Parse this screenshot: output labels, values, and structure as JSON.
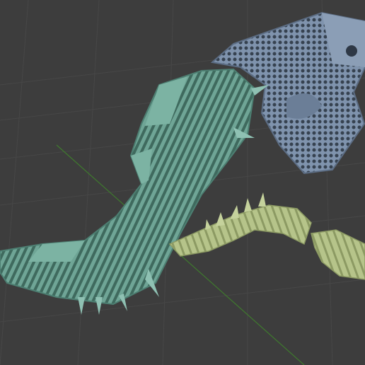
{
  "viewport": {
    "type": "3d-viewport",
    "background_color": "#3d3d3d",
    "grid_color": "#474747",
    "axis_y_color": "#3f7a2e",
    "objects": [
      {
        "name": "blue-grey-skull-head-part",
        "color": "#7f93ad"
      },
      {
        "name": "teal-ribbed-body-segment",
        "color": "#6fa596"
      },
      {
        "name": "olive-tail-spine-part",
        "color": "#b6c48a"
      },
      {
        "name": "olive-tail-end-part",
        "color": "#b6c48a"
      }
    ]
  }
}
